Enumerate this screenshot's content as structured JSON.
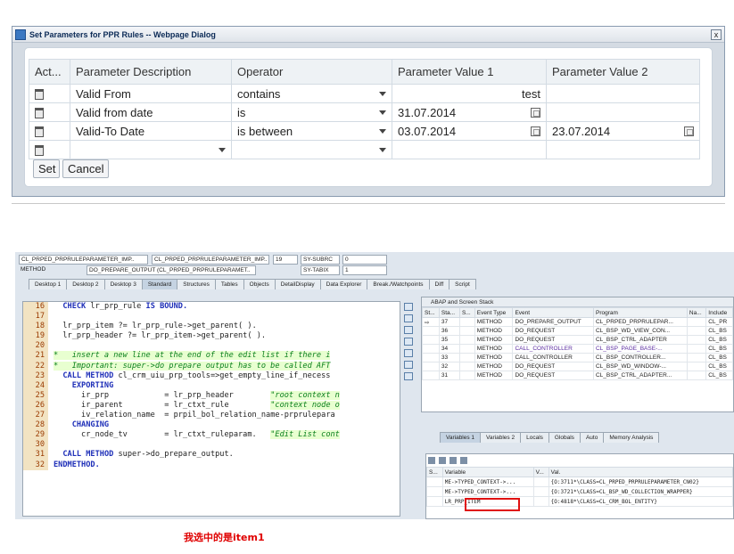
{
  "dialog": {
    "title": "Set Parameters for PPR Rules -- Webpage Dialog",
    "close_label": "x",
    "columns": [
      "Act...",
      "Parameter Description",
      "Operator",
      "Parameter Value 1",
      "Parameter Value 2"
    ],
    "rows": [
      {
        "description": "Valid From",
        "operator": "contains",
        "value1": "test",
        "value2": ""
      },
      {
        "description": "Valid from date",
        "operator": "is",
        "value1": "31.07.2014",
        "value2": ""
      },
      {
        "description": "Valid-To Date",
        "operator": "is between",
        "value1": "03.07.2014",
        "value2": "23.07.2014"
      },
      {
        "description": "",
        "operator": "",
        "value1": "",
        "value2": ""
      }
    ],
    "set_label": "Set",
    "cancel_label": "Cancel"
  },
  "debugger": {
    "header": {
      "include1": "CL_PRPED_PRPRULEPARAMETER_IMP..",
      "include2": "CL_PRPED_PRPRULEPARAMETER_IMP..",
      "line": "19",
      "subrc_label": "SY-SUBRC",
      "subrc_value": "0",
      "method_label": "METHOD",
      "method_name": "DO_PREPARE_OUTPUT (CL_PRPED_PRPRULEPARAMET..",
      "tabix_label": "SY-TABIX",
      "tabix_value": "1"
    },
    "tabs": [
      "Desktop 1",
      "Desktop 2",
      "Desktop 3",
      "Standard",
      "Structures",
      "Tables",
      "Objects",
      "DetailDisplay",
      "Data Explorer",
      "Break./Watchpoints",
      "Diff",
      "Script"
    ],
    "code": [
      {
        "n": "16",
        "t": "  CHECK lr_prp_rule IS BOUND."
      },
      {
        "n": "17",
        "t": ""
      },
      {
        "n": "18",
        "t": "  lr_prp_item ?= lr_prp_rule->get_parent( )."
      },
      {
        "n": "19",
        "t": "  lr_prp_header ?= lr_prp_item->get_parent( )."
      },
      {
        "n": "20",
        "t": ""
      },
      {
        "n": "21",
        "t": "*   insert a new line at the end of the edit list if there i"
      },
      {
        "n": "22",
        "t": "*   Important: super->do prepare output has to be called AFT"
      },
      {
        "n": "23",
        "t": "  CALL METHOD cl_crm_uiu_prp_tools=>get_empty_line_if_necess"
      },
      {
        "n": "24",
        "t": "    EXPORTING"
      },
      {
        "n": "25",
        "t": "      ir_prp            = lr_prp_header        \"root context n"
      },
      {
        "n": "26",
        "t": "      ir_parent         = lr_ctxt_rule         \"context node o"
      },
      {
        "n": "27",
        "t": "      iv_relation_name  = prpil_bol_relation_name-prprulepara"
      },
      {
        "n": "28",
        "t": "    CHANGING"
      },
      {
        "n": "29",
        "t": "      cr_node_tv        = lr_ctxt_ruleparam.   \"Edit List cont"
      },
      {
        "n": "30",
        "t": ""
      },
      {
        "n": "31",
        "t": "  CALL METHOD super->do_prepare_output."
      },
      {
        "n": "32",
        "t": "ENDMETHOD."
      }
    ],
    "annotation": "我选中的是item1",
    "stack": {
      "title": "ABAP and Screen Stack",
      "columns": [
        "St...",
        "Sta...",
        "S...",
        "Event Type",
        "Event",
        "Program",
        "Na...",
        "Include"
      ],
      "rows": [
        {
          "level": "37",
          "type": "METHOD",
          "event": "DO_PREPARE_OUTPUT",
          "program": "CL_PRPED_PRPRULEPAR...",
          "include": "CL_PR"
        },
        {
          "level": "36",
          "type": "METHOD",
          "event": "DO_REQUEST",
          "program": "CL_BSP_WD_VIEW_CON...",
          "include": "CL_BS"
        },
        {
          "level": "35",
          "type": "METHOD",
          "event": "DO_REQUEST",
          "program": "CL_BSP_CTRL_ADAPTER",
          "include": "CL_BS"
        },
        {
          "level": "34",
          "type": "METHOD",
          "event": "CALL_CONTROLLER",
          "program": "CL_BSP_PAGE_BASE-...",
          "include": "CL_BS"
        },
        {
          "level": "33",
          "type": "METHOD",
          "event": "CALL_CONTROLLER",
          "program": "CL_BSP_CONTROLLER...",
          "include": "CL_BS"
        },
        {
          "level": "32",
          "type": "METHOD",
          "event": "DO_REQUEST",
          "program": "CL_BSP_WD_WINDOW-...",
          "include": "CL_BS"
        },
        {
          "level": "31",
          "type": "METHOD",
          "event": "DO_REQUEST",
          "program": "CL_BSP_CTRL_ADAPTER...",
          "include": "CL_BS"
        }
      ]
    },
    "var_tabs": [
      "Variables 1",
      "Variables 2",
      "Locals",
      "Globals",
      "Auto",
      "Memory Analysis"
    ],
    "vars": {
      "columns": [
        "S...",
        "Variable",
        "V...",
        "Val."
      ],
      "rows": [
        {
          "name": "ME->TYPED_CONTEXT->...",
          "value": "{O:3711*\\CLASS=CL_PRPED_PRPRULEPARAMETER_CN02}"
        },
        {
          "name": "ME->TYPED_CONTEXT->...",
          "value": "{O:3721*\\CLASS=CL_BSP_WD_COLLECTION_WRAPPER}"
        },
        {
          "name": "LR_PRP_ITEM",
          "value": "{O:4818*\\CLASS=CL_CRM_BOL_ENTITY}"
        }
      ]
    }
  }
}
